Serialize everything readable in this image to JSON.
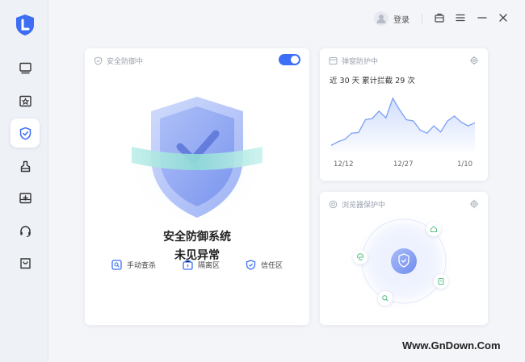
{
  "titlebar": {
    "login_label": "登录",
    "icons": [
      "user-avatar-icon",
      "bag-icon",
      "menu-icon",
      "minimize-icon",
      "close-icon"
    ]
  },
  "sidebar": {
    "logo": "app-logo",
    "items": [
      {
        "name": "monitor",
        "icon": "monitor-icon",
        "active": false
      },
      {
        "name": "star-badge",
        "icon": "star-badge-icon",
        "active": false
      },
      {
        "name": "protection",
        "icon": "shield-check-icon",
        "active": true
      },
      {
        "name": "cleanup",
        "icon": "broom-icon",
        "active": false
      },
      {
        "name": "toolbox",
        "icon": "toolbox-icon",
        "active": false
      },
      {
        "name": "support",
        "icon": "headset-icon",
        "active": false
      },
      {
        "name": "store",
        "icon": "store-bag-icon",
        "active": false
      }
    ]
  },
  "protection_card": {
    "title": "安全防御中",
    "toggle_on": true,
    "status_line1": "安全防御系统",
    "status_line2": "未见异常",
    "actions": [
      {
        "label": "手动查杀",
        "icon": "scan-icon"
      },
      {
        "label": "隔离区",
        "icon": "quarantine-icon"
      },
      {
        "label": "信任区",
        "icon": "trust-shield-icon"
      }
    ]
  },
  "popup_card": {
    "title": "弹窗防护中",
    "caption": "近 30 天 累计拦截 29 次"
  },
  "browser_card": {
    "title": "浏览器保护中",
    "orbit_icons": [
      "home-icon",
      "edge-icon",
      "bookmark-icon",
      "search-icon"
    ]
  },
  "chart_data": {
    "type": "area",
    "title": "近 30 天 累计拦截 29 次",
    "x_tick_labels": [
      "12/12",
      "12/27",
      "1/10"
    ],
    "values": [
      1,
      1.6,
      2,
      3,
      3.1,
      5.2,
      5.4,
      6.6,
      5.5,
      8.7,
      6.8,
      5.2,
      5,
      3.5,
      3,
      4.2,
      3.2,
      5,
      5.8,
      4.8,
      4.2,
      4.7
    ],
    "ylim": [
      0,
      10
    ],
    "color": "#7a9ef5",
    "grid": false
  },
  "watermark": "Www.GnDown.Com",
  "colors": {
    "accent": "#3d6ef5",
    "shield": "#7f9cf6",
    "ring": "#7fd8d4",
    "sidebar_bg": "#eef1f6"
  }
}
